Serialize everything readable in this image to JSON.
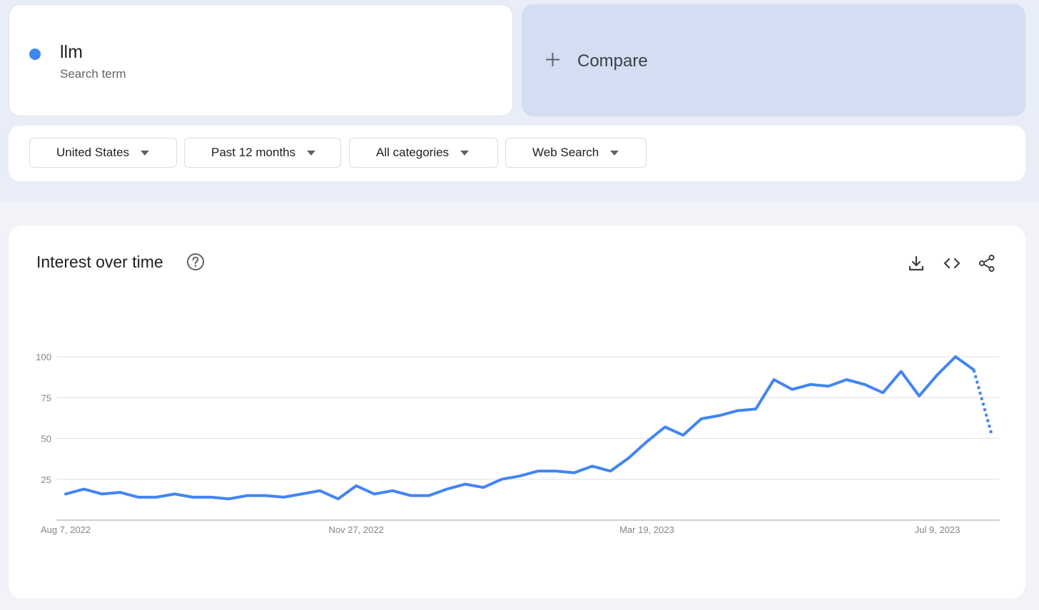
{
  "search_term": {
    "name": "llm",
    "sublabel": "Search term",
    "color": "#4285f4"
  },
  "compare": {
    "label": "Compare",
    "icon": "plus-icon"
  },
  "filters": [
    {
      "label": "United States",
      "icon": "dropdown-arrow-icon"
    },
    {
      "label": "Past 12 months",
      "icon": "dropdown-arrow-icon"
    },
    {
      "label": "All categories",
      "icon": "dropdown-arrow-icon"
    },
    {
      "label": "Web Search",
      "icon": "dropdown-arrow-icon"
    }
  ],
  "interest_panel": {
    "title": "Interest over time",
    "help_icon": "help-circle-icon",
    "actions": [
      "download-icon",
      "embed-code-icon",
      "share-icon"
    ]
  },
  "chart_data": {
    "type": "line",
    "title": "",
    "xlabel": "",
    "ylabel": "",
    "ylim": [
      0,
      100
    ],
    "yticks": [
      25,
      50,
      75,
      100
    ],
    "xtick_labels": [
      "Aug 7, 2022",
      "Nov 27, 2022",
      "Mar 19, 2023",
      "Jul 9, 2023"
    ],
    "grid": true,
    "line_color": "#4285f4",
    "series": [
      {
        "values": [
          16,
          19,
          16,
          17,
          14,
          14,
          16,
          14,
          14,
          13,
          15,
          15,
          14,
          16,
          18,
          13,
          21,
          16,
          18,
          15,
          15,
          19,
          22,
          20,
          25,
          27,
          30,
          30,
          29,
          33,
          30,
          38,
          48,
          57,
          52,
          62,
          64,
          67,
          68,
          86,
          80,
          83,
          82,
          86,
          83,
          78,
          91,
          76,
          89,
          100,
          92,
          52
        ],
        "partial_last_point": true
      }
    ]
  }
}
